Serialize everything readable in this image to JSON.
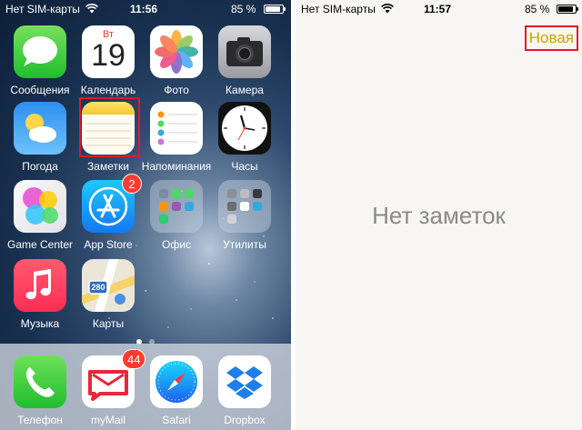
{
  "left_status": {
    "carrier": "Нет SIM-карты",
    "time": "11:56",
    "battery": "85 %"
  },
  "right_status": {
    "carrier": "Нет SIM-карты",
    "time": "11:57",
    "battery": "85 %"
  },
  "apps": {
    "messages": "Сообщения",
    "calendar": "Календарь",
    "calendar_weekday": "Вт",
    "calendar_day": "19",
    "photos": "Фото",
    "camera": "Камера",
    "weather": "Погода",
    "notes": "Заметки",
    "reminders": "Напоминания",
    "clock": "Часы",
    "game_center": "Game Center",
    "app_store": "App Store",
    "app_store_badge": "2",
    "office": "Офис",
    "utilities": "Утилиты",
    "music": "Музыка",
    "maps": "Карты",
    "maps_shield": "280"
  },
  "dock": {
    "phone": "Телефон",
    "mymail": "myMail",
    "mymail_badge": "44",
    "safari": "Safari",
    "dropbox": "Dropbox"
  },
  "notes_screen": {
    "new_button": "Новая",
    "empty_text": "Нет заметок",
    "accent_color": "#cca300"
  },
  "highlight_color": "#e0182c"
}
